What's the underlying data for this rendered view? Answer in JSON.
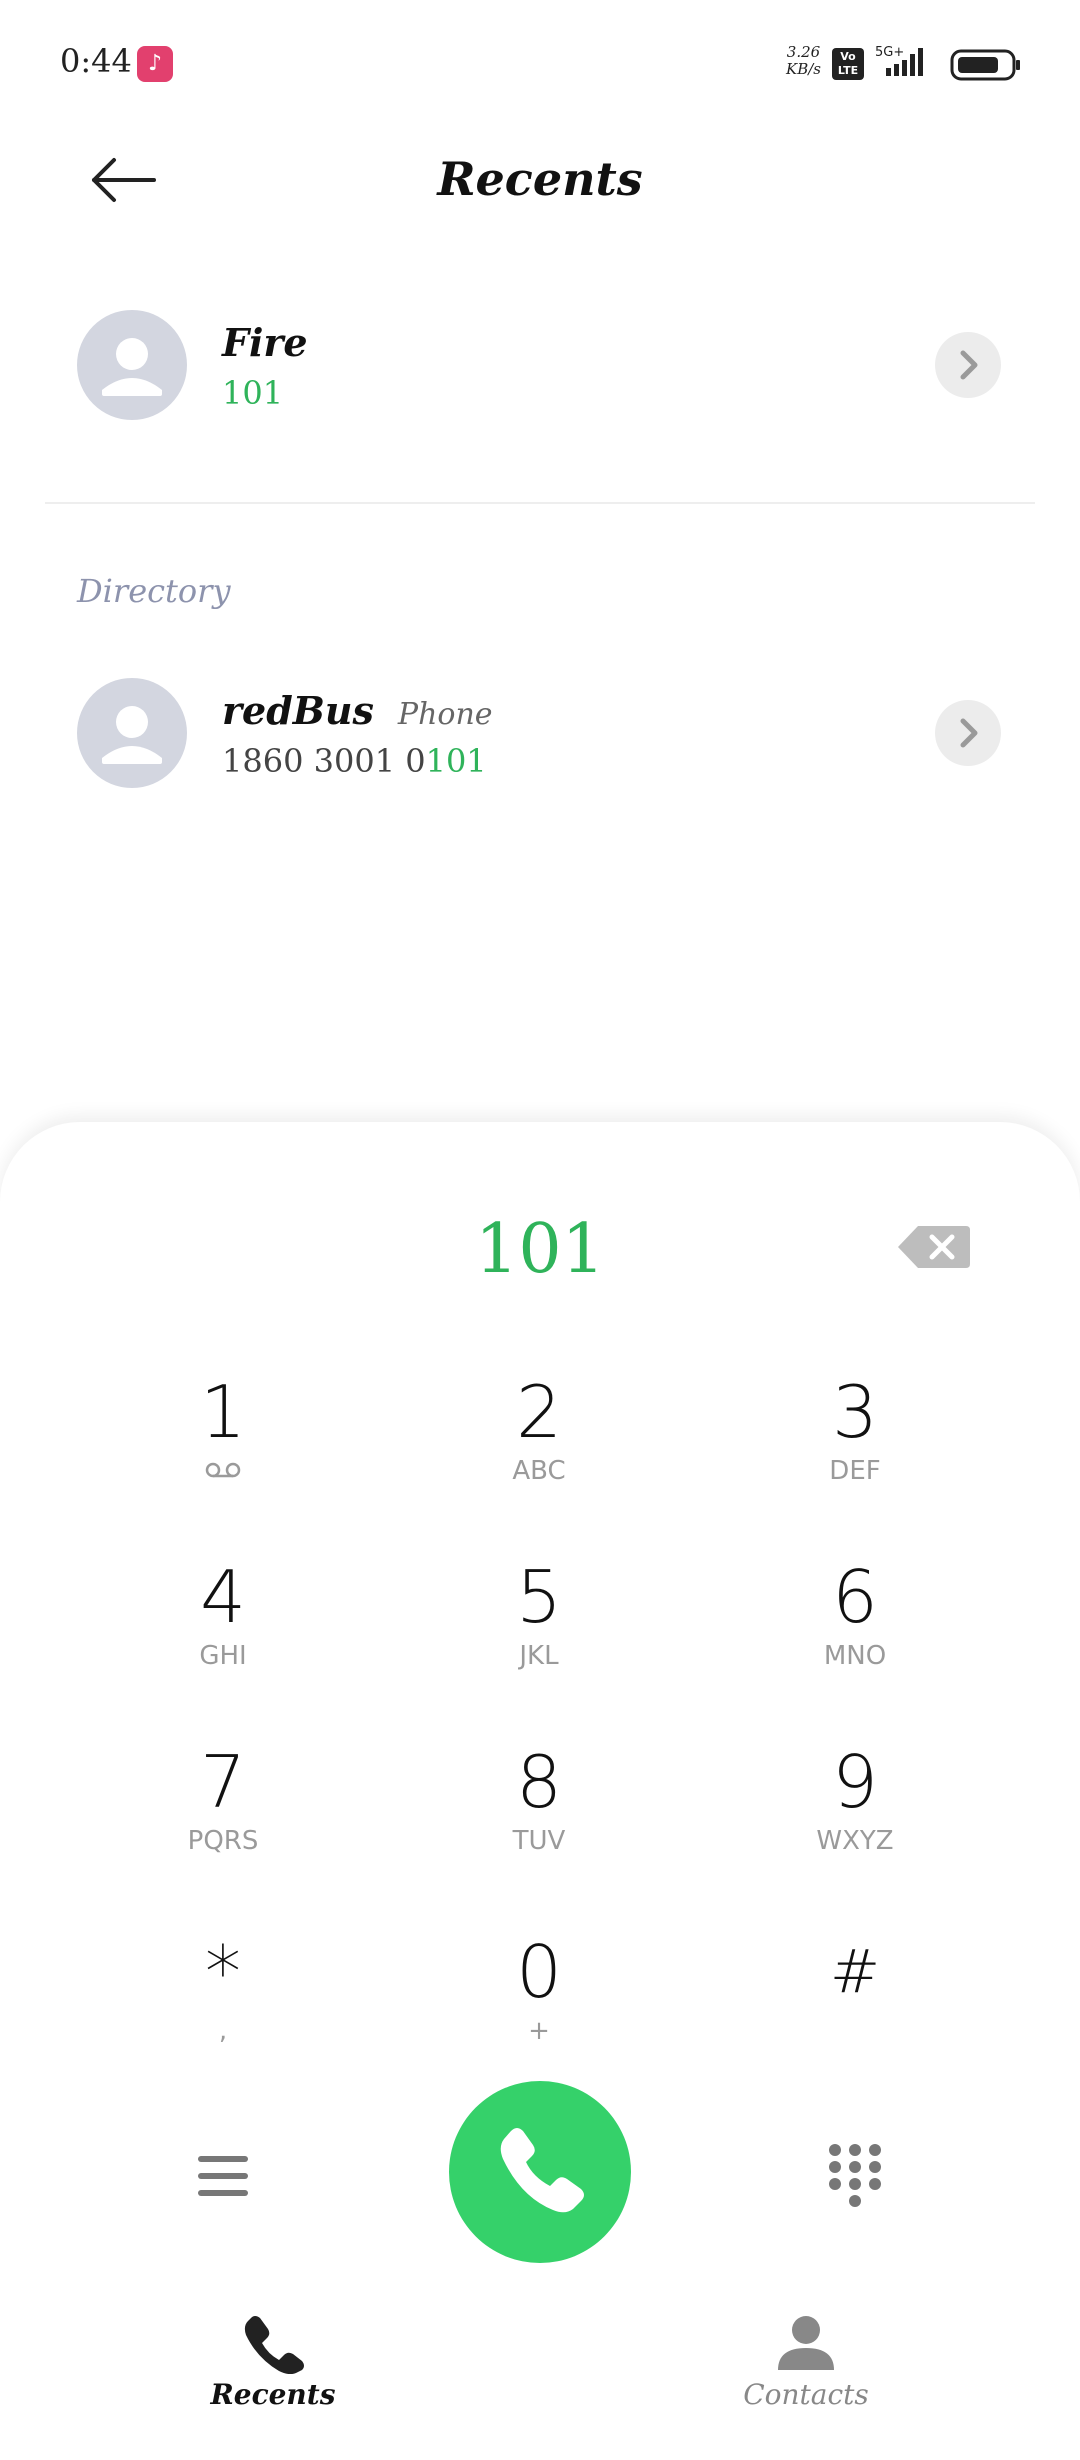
{
  "status_bar": {
    "time": "0:44",
    "net_speed_value": "3.26",
    "net_speed_unit": "KB/s",
    "volte": "Vo LTE",
    "network": "5G+",
    "battery_level": 0.8
  },
  "header": {
    "title": "Recents",
    "back_icon": "arrow-left-icon"
  },
  "results": [
    {
      "name": "Fire",
      "tag": "",
      "number_plain": "",
      "number_match": "101"
    }
  ],
  "directory": {
    "header": "Directory",
    "items": [
      {
        "name": "redBus",
        "tag": "Phone",
        "number_plain": "1860 3001 0",
        "number_match": "101"
      }
    ]
  },
  "dialer": {
    "number": "101",
    "keys": [
      {
        "digit": "1",
        "letters": ""
      },
      {
        "digit": "2",
        "letters": "ABC"
      },
      {
        "digit": "3",
        "letters": "DEF"
      },
      {
        "digit": "4",
        "letters": "GHI"
      },
      {
        "digit": "5",
        "letters": "JKL"
      },
      {
        "digit": "6",
        "letters": "MNO"
      },
      {
        "digit": "7",
        "letters": "PQRS"
      },
      {
        "digit": "8",
        "letters": "TUV"
      },
      {
        "digit": "9",
        "letters": "WXYZ"
      },
      {
        "digit": "*",
        "letters": ","
      },
      {
        "digit": "0",
        "letters": "+"
      },
      {
        "digit": "#",
        "letters": ""
      }
    ]
  },
  "bottom_nav": {
    "recents_label": "Recents",
    "contacts_label": "Contacts"
  },
  "colors": {
    "accent_green": "#35d16a",
    "match_green": "#2fb35a",
    "avatar_bg": "#d3d6e0",
    "section_header": "#8d93ad"
  }
}
